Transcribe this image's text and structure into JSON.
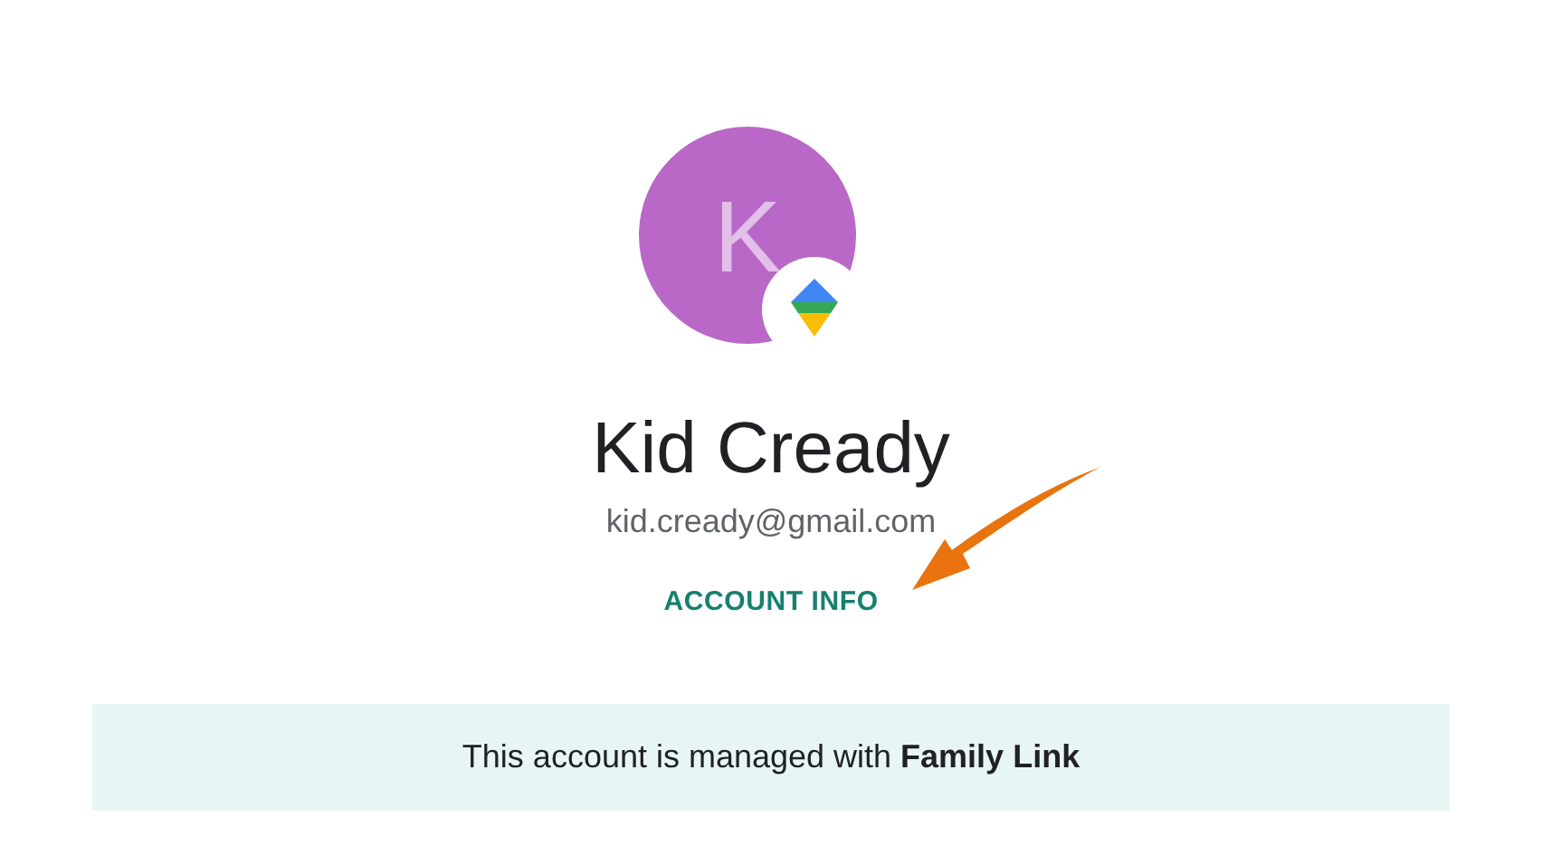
{
  "profile": {
    "avatar_letter": "K",
    "name": "Kid Cready",
    "email": "kid.cready@gmail.com"
  },
  "account_info_link": "ACCOUNT INFO",
  "banner": "This account is managed with **Family Link**"
}
